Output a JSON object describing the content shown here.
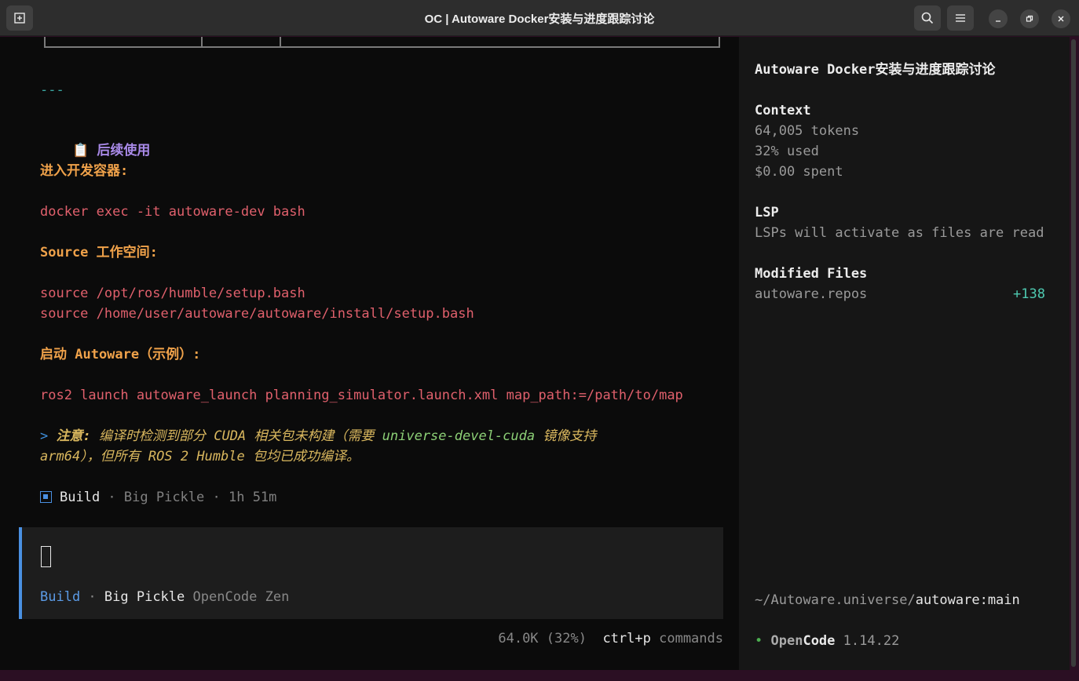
{
  "window": {
    "title": "OC | Autoware Docker安装与进度跟踪讨论",
    "icons": {
      "new_tab": "new-tab-icon",
      "search": "search-icon",
      "menu": "hamburger-menu-icon",
      "minimize": "minimize-icon",
      "restore": "restore-icon",
      "close": "close-icon"
    }
  },
  "main": {
    "hr": "---",
    "section_icon": "📋",
    "section_title": "后续使用",
    "label_enter": "进入开发容器:",
    "cmd_enter": "docker exec -it autoware-dev bash",
    "label_source": "Source 工作空间:",
    "cmd_source_1": "source /opt/ros/humble/setup.bash",
    "cmd_source_2": "source /home/user/autoware/autoware/install/setup.bash",
    "label_launch": "启动 Autoware（示例）:",
    "cmd_launch": "ros2 launch autoware_launch planning_simulator.launch.xml map_path:=/path/to/map",
    "note": {
      "marker": ">",
      "bold": "注意:",
      "text_1": " 编译时检测到部分 CUDA 相关包未构建（需要 ",
      "highlight": "universe-devel-cuda",
      "text_2": " 镜像支持",
      "line_2": "arm64），但所有 ROS 2 Humble 包均已成功编译。"
    },
    "build_status": {
      "mode": "Build",
      "sep": " · ",
      "model": "Big Pickle",
      "duration": "1h 51m"
    }
  },
  "prompt": {
    "mode": "Build",
    "sep": " · ",
    "model": "Big Pickle",
    "provider": "OpenCode Zen"
  },
  "footer": {
    "usage": "64.0K (32%)",
    "shortcut": "ctrl+p",
    "shortcut_label": "commands"
  },
  "sidebar": {
    "title": "Autoware Docker安装与进度跟踪讨论",
    "context": {
      "heading": "Context",
      "tokens": "64,005 tokens",
      "used": "32% used",
      "spent": "$0.00 spent"
    },
    "lsp": {
      "heading": "LSP",
      "text": "LSPs will activate as files are read"
    },
    "modified": {
      "heading": "Modified Files",
      "file": "autoware.repos",
      "diff": "+138"
    },
    "path_prefix": "~/Autoware.universe/",
    "path_branch": "autoware:main",
    "app": {
      "dot": "•",
      "name_open": "Open",
      "name_code": "Code",
      "version": "1.14.22"
    }
  }
}
